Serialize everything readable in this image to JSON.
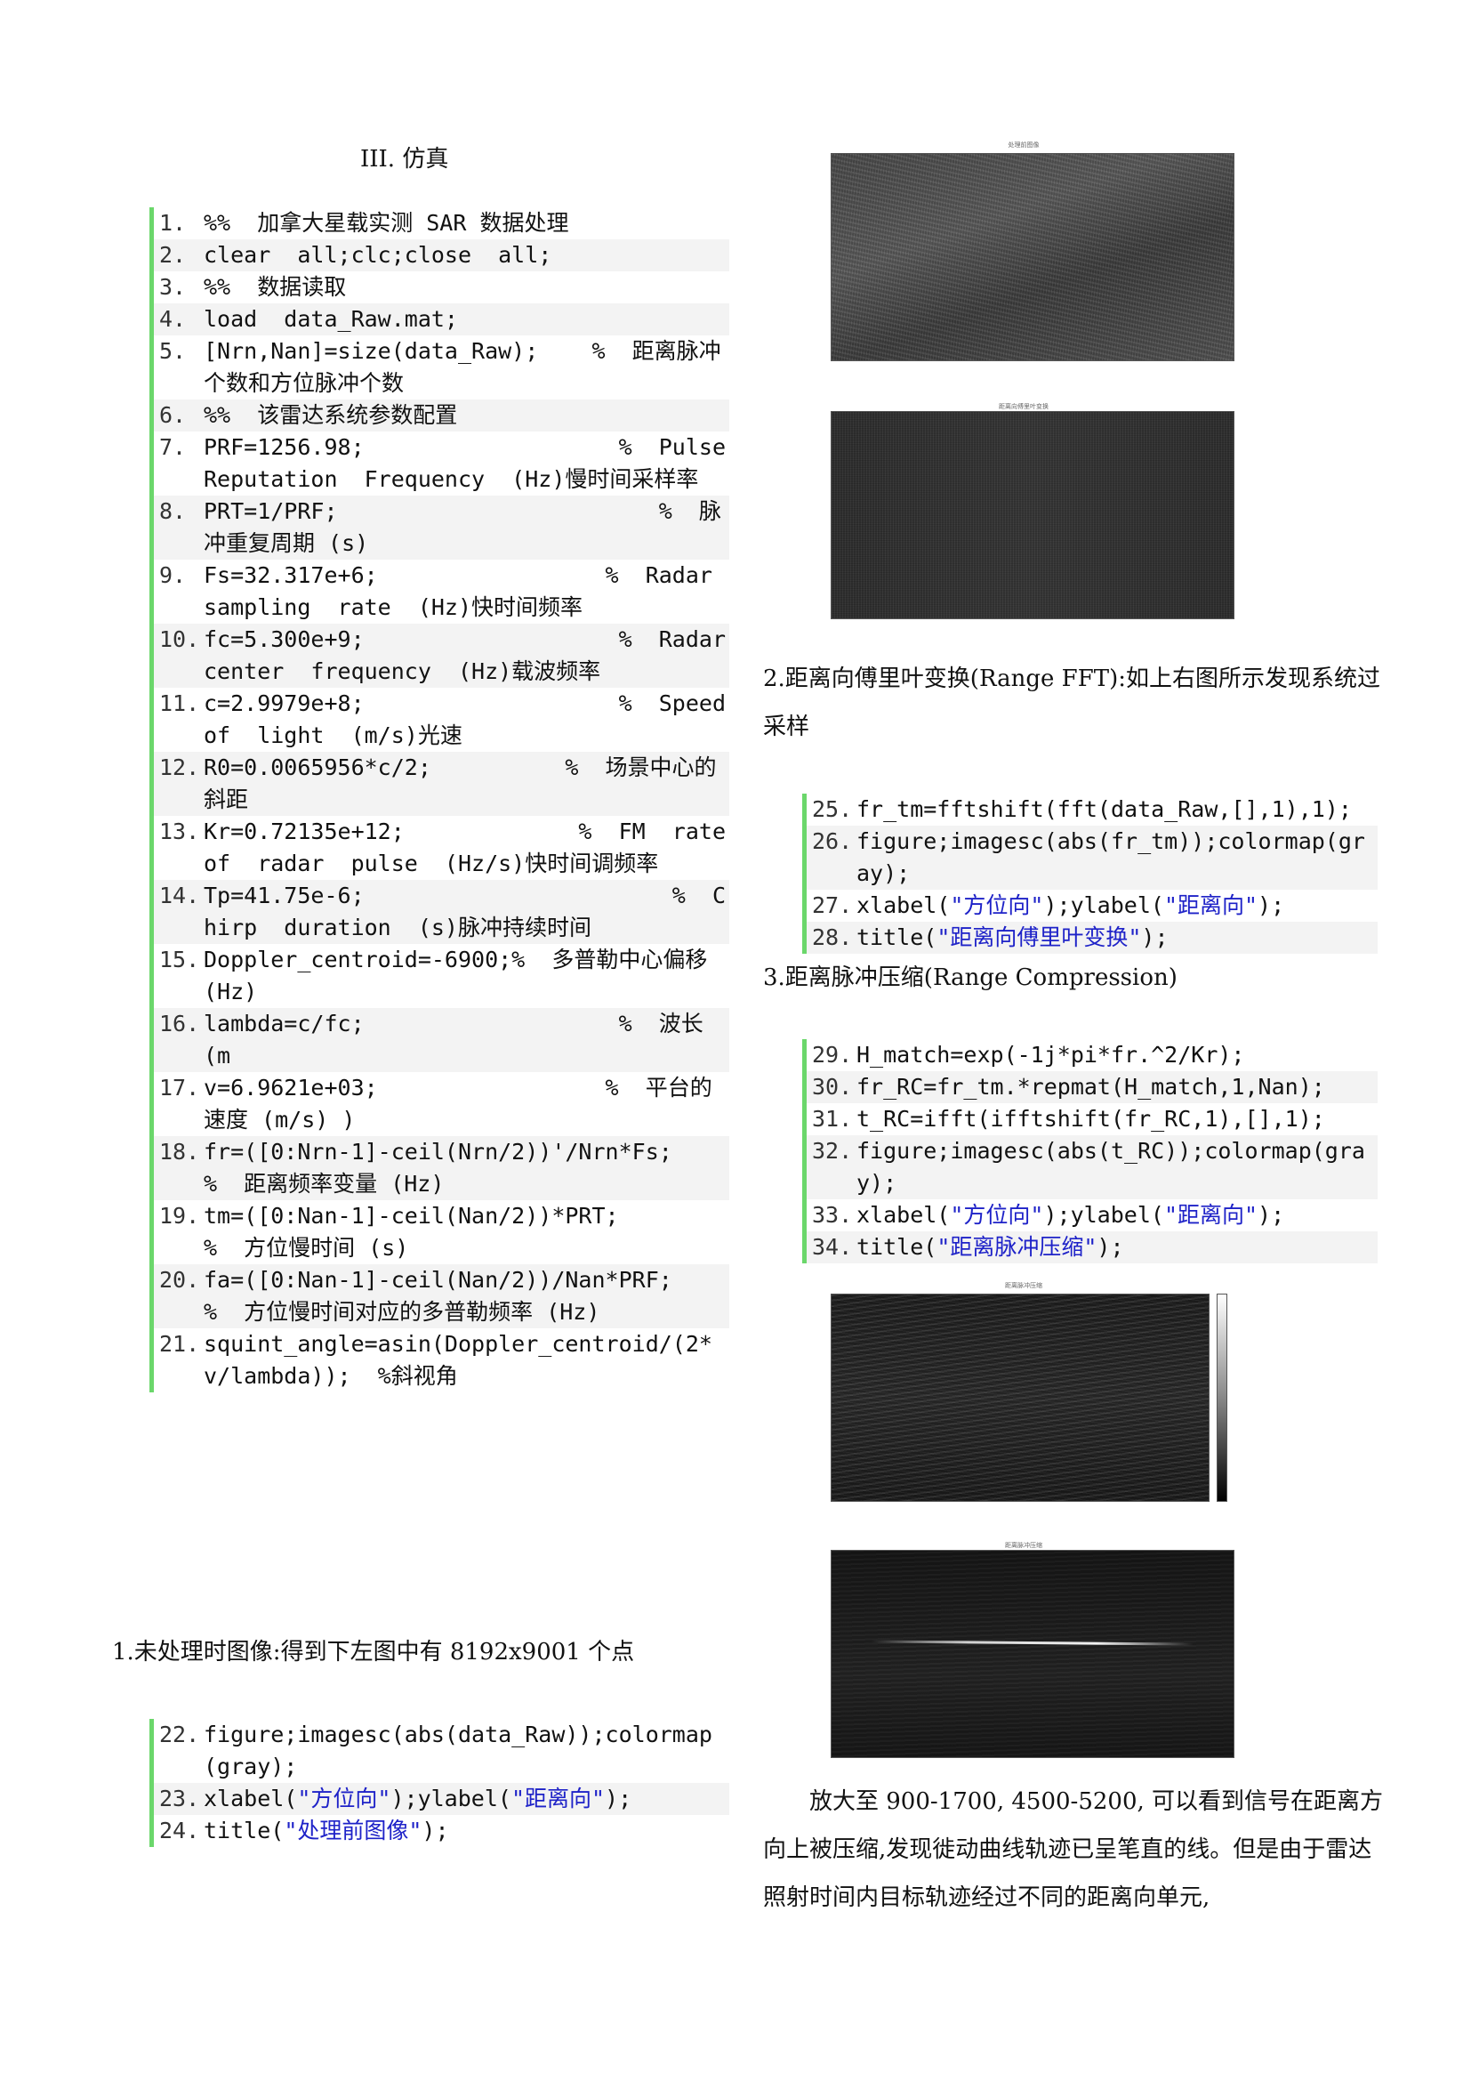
{
  "section_heading": "III. 仿真",
  "code_block_1": [
    {
      "n": "1.",
      "segs": [
        {
          "t": "%%  加拿大星载实测 SAR 数据处理"
        }
      ]
    },
    {
      "n": "2.",
      "segs": [
        {
          "t": "clear  all;clc;close  all;"
        }
      ]
    },
    {
      "n": "3.",
      "segs": [
        {
          "t": "%%  数据读取"
        }
      ]
    },
    {
      "n": "4.",
      "segs": [
        {
          "t": "load  data_Raw.mat;"
        }
      ]
    },
    {
      "n": "5.",
      "segs": [
        {
          "t": "[Nrn,Nan]=size(data_Raw);    %  距离脉冲个数和方位脉冲个数"
        }
      ]
    },
    {
      "n": "6.",
      "segs": [
        {
          "t": "%%  该雷达系统参数配置"
        }
      ]
    },
    {
      "n": "7.",
      "segs": [
        {
          "t": "PRF=1256.98;                   %  Pulse  Reputation  Frequency  (Hz)慢时间采样率"
        }
      ]
    },
    {
      "n": "8.",
      "segs": [
        {
          "t": "PRT=1/PRF;                        %  脉冲重复周期 (s)"
        }
      ]
    },
    {
      "n": "9.",
      "segs": [
        {
          "t": "Fs=32.317e+6;                 %  Radar  sampling  rate  (Hz)快时间频率"
        }
      ]
    },
    {
      "n": "10.",
      "segs": [
        {
          "t": "fc=5.300e+9;                   %  Radar  center  frequency  (Hz)载波频率"
        }
      ]
    },
    {
      "n": "11.",
      "segs": [
        {
          "t": "c=2.9979e+8;                   %  Speed  of  light  (m/s)光速"
        }
      ]
    },
    {
      "n": "12.",
      "segs": [
        {
          "t": "R0=0.0065956*c/2;          %  场景中心的斜距"
        }
      ]
    },
    {
      "n": "13.",
      "segs": [
        {
          "t": "Kr=0.72135e+12;             %  FM  rate  of  radar  pulse  (Hz/s)快时间调频率"
        }
      ]
    },
    {
      "n": "14.",
      "segs": [
        {
          "t": "Tp=41.75e-6;                       %  Chirp  duration  (s)脉冲持续时间"
        }
      ]
    },
    {
      "n": "15.",
      "segs": [
        {
          "t": "Doppler_centroid=-6900;%  多普勒中心偏移 (Hz)"
        }
      ]
    },
    {
      "n": "16.",
      "segs": [
        {
          "t": "lambda=c/fc;                   %  波长 (m"
        }
      ]
    },
    {
      "n": "17.",
      "segs": [
        {
          "t": "v=6.9621e+03;                 %  平台的速度 (m/s) )"
        }
      ]
    },
    {
      "n": "18.",
      "segs": [
        {
          "t": "fr=([0:Nrn-1]-ceil(Nrn/2))'/Nrn*Fs;           %  距离频率变量 (Hz)"
        }
      ]
    },
    {
      "n": "19.",
      "segs": [
        {
          "t": "tm=([0:Nan-1]-ceil(Nan/2))*PRT;                   %  方位慢时间 (s)"
        }
      ]
    },
    {
      "n": "20.",
      "segs": [
        {
          "t": "fa=([0:Nan-1]-ceil(Nan/2))/Nan*PRF;           %  方位慢时间对应的多普勒频率 (Hz)"
        }
      ]
    },
    {
      "n": "21.",
      "segs": [
        {
          "t": "squint_angle=asin(Doppler_centroid/(2*v/lambda));  %斜视角"
        }
      ]
    }
  ],
  "para_1": "1.未处理时图像:得到下左图中有 8192x9001 个点",
  "code_block_2": [
    {
      "n": "22.",
      "segs": [
        {
          "t": "figure;imagesc(abs(data_Raw));colormap(gray);"
        }
      ]
    },
    {
      "n": "23.",
      "segs": [
        {
          "t": "xlabel("
        },
        {
          "t": "\"方位向\"",
          "c": "str"
        },
        {
          "t": ");ylabel("
        },
        {
          "t": "\"距离向\"",
          "c": "str"
        },
        {
          "t": ");"
        }
      ]
    },
    {
      "n": "24.",
      "segs": [
        {
          "t": "title("
        },
        {
          "t": "\"处理前图像\"",
          "c": "str"
        },
        {
          "t": ");"
        }
      ]
    }
  ],
  "para_2": "2.距离向傅里叶变换(Range FFT):如上右图所示发现系统过采样",
  "code_block_3": [
    {
      "n": "25.",
      "segs": [
        {
          "t": "fr_tm=fftshift(fft(data_Raw,[],1),1);"
        }
      ]
    },
    {
      "n": "26.",
      "segs": [
        {
          "t": "figure;imagesc(abs(fr_tm));colormap(gray);"
        }
      ]
    },
    {
      "n": "27.",
      "segs": [
        {
          "t": "xlabel("
        },
        {
          "t": "\"方位向\"",
          "c": "str"
        },
        {
          "t": ");ylabel("
        },
        {
          "t": "\"距离向\"",
          "c": "str"
        },
        {
          "t": ");"
        }
      ]
    },
    {
      "n": "28.",
      "segs": [
        {
          "t": "title("
        },
        {
          "t": "\"距离向傅里叶变换\"",
          "c": "str"
        },
        {
          "t": ");"
        }
      ]
    }
  ],
  "para_3": "3.距离脉冲压缩(Range Compression)",
  "code_block_4": [
    {
      "n": "29.",
      "segs": [
        {
          "t": "H_match=exp(-1j*pi*fr.^2/Kr);"
        }
      ]
    },
    {
      "n": "30.",
      "segs": [
        {
          "t": "fr_RC=fr_tm.*repmat(H_match,1,Nan);"
        }
      ]
    },
    {
      "n": "31.",
      "segs": [
        {
          "t": "t_RC=ifft(ifftshift(fr_RC,1),[],1);"
        }
      ]
    },
    {
      "n": "32.",
      "segs": [
        {
          "t": "figure;imagesc(abs(t_RC));colormap(gray);"
        }
      ]
    },
    {
      "n": "33.",
      "segs": [
        {
          "t": "xlabel("
        },
        {
          "t": "\"方位向\"",
          "c": "str"
        },
        {
          "t": ");ylabel("
        },
        {
          "t": "\"距离向\"",
          "c": "str"
        },
        {
          "t": ");"
        }
      ]
    },
    {
      "n": "34.",
      "segs": [
        {
          "t": "title("
        },
        {
          "t": "\"距离脉冲压缩\"",
          "c": "str"
        },
        {
          "t": ");"
        }
      ]
    }
  ],
  "para_4": "放大至 900-1700, 4500-5200, 可以看到信号在距离方向上被压缩,发现徙动曲线轨迹已呈笔直的线。但是由于雷达照射时间内目标轨迹经过不同的距离向单元,",
  "figures": {
    "fig1_title": "处理前图像",
    "fig2_title": "距离向傅里叶变换",
    "fig3_title": "距离脉冲压缩",
    "fig4_title": "距离脉冲压缩"
  }
}
